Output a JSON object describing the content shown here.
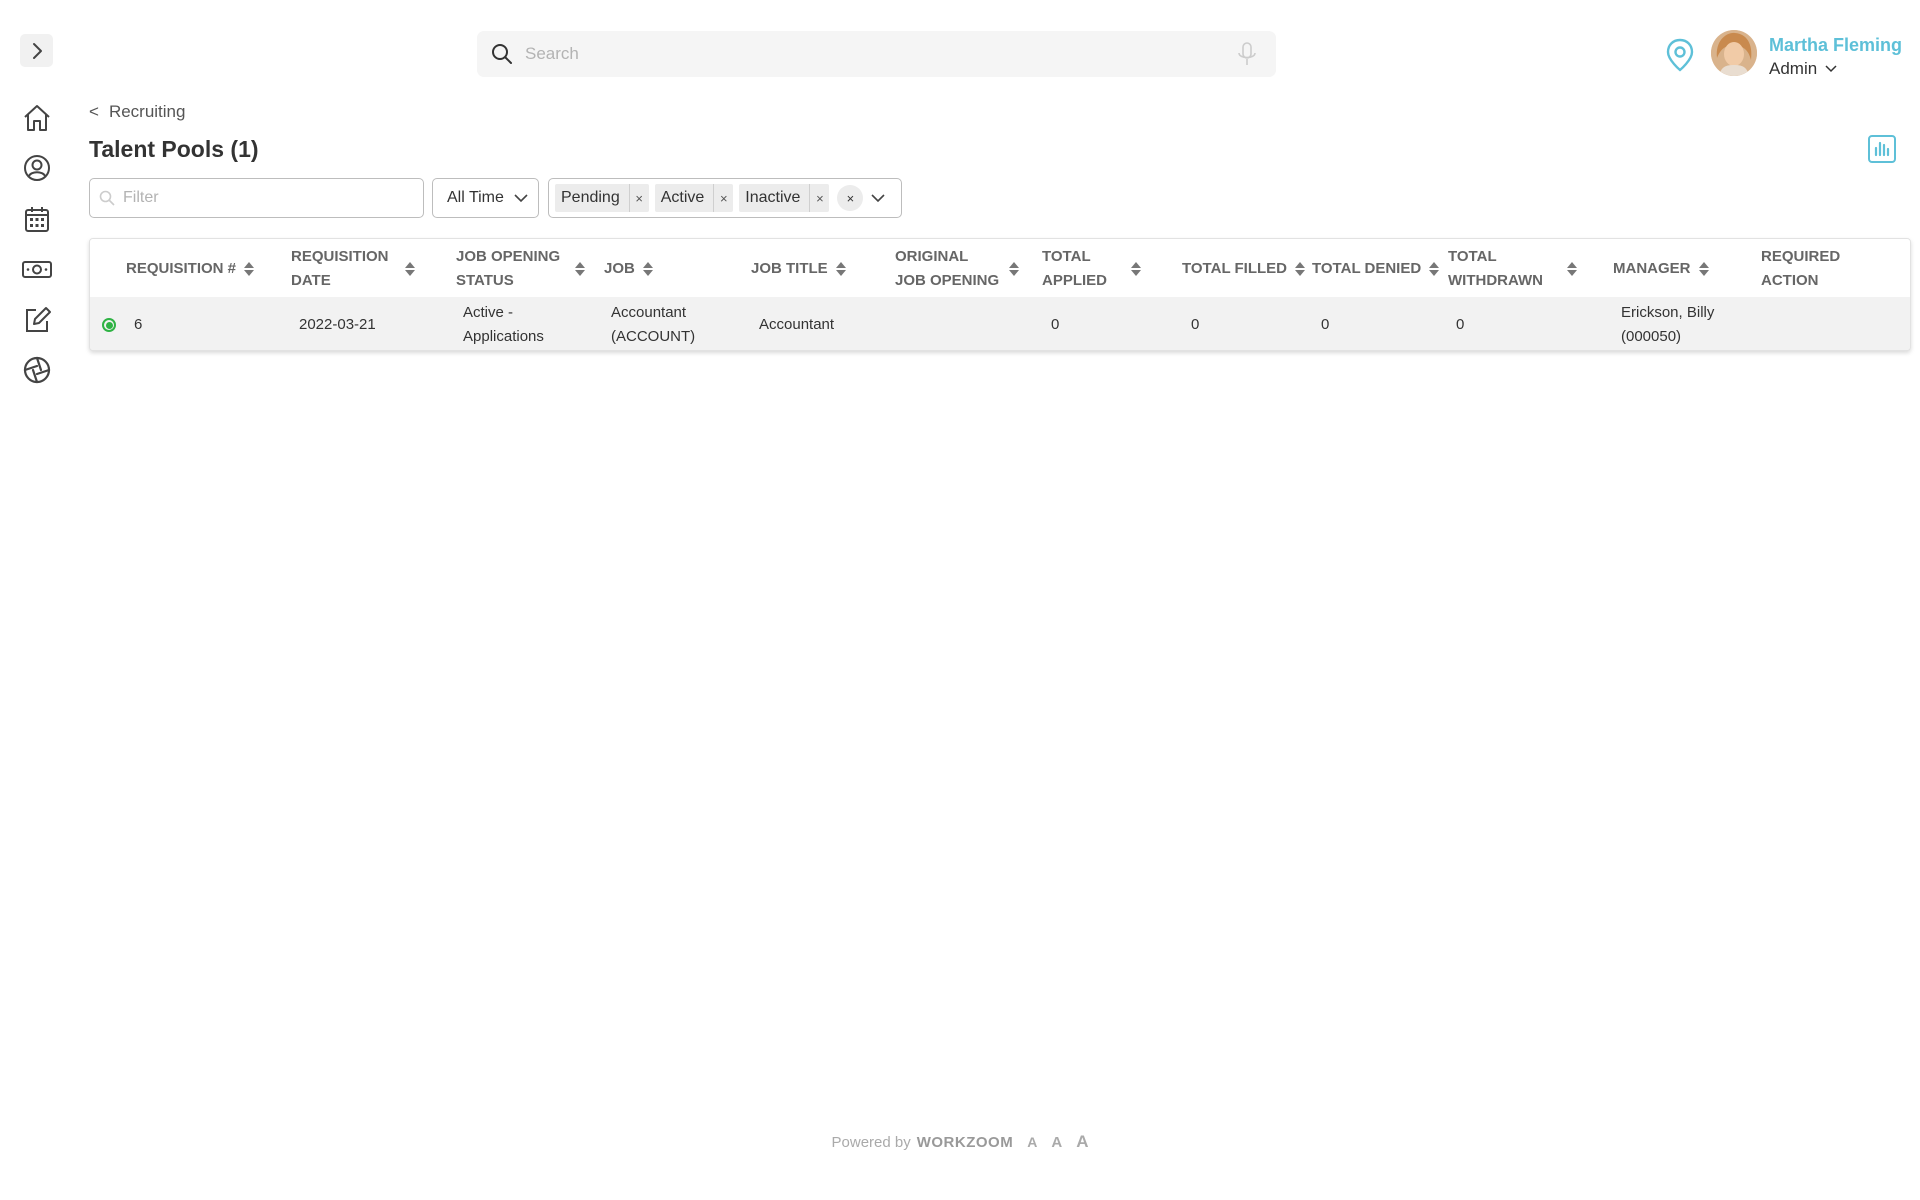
{
  "search": {
    "placeholder": "Search"
  },
  "user": {
    "name": "Martha Fleming",
    "role": "Admin"
  },
  "breadcrumb": {
    "chevron": "<",
    "label": "Recruiting"
  },
  "page": {
    "title": "Talent Pools (1)"
  },
  "filters": {
    "filter_placeholder": "Filter",
    "time_range": "All Time",
    "statuses": [
      "Pending",
      "Active",
      "Inactive"
    ],
    "chip_remove": "×",
    "clear_all": "×"
  },
  "table": {
    "columns": [
      "REQUISITION #",
      "REQUISITION DATE",
      "JOB OPENING STATUS",
      "JOB",
      "JOB TITLE",
      "ORIGINAL JOB OPENING",
      "TOTAL APPLIED",
      "TOTAL FILLED",
      "TOTAL DENIED",
      "TOTAL WITHDRAWN",
      "MANAGER",
      "REQUIRED ACTION"
    ],
    "rows": [
      {
        "requisition": "6",
        "date": "2022-03-21",
        "status": "Active - Applications",
        "job": "Accountant (ACCOUNT)",
        "job_title": "Accountant",
        "original_job_opening": "",
        "total_applied": "0",
        "total_filled": "0",
        "total_denied": "0",
        "total_withdrawn": "0",
        "manager": "Erickson, Billy (000050)",
        "required_action": ""
      }
    ]
  },
  "footer": {
    "powered_by": "Powered by",
    "brand": "WORKZOOM",
    "font_sizes": [
      "A",
      "A",
      "A"
    ]
  },
  "colors": {
    "accent": "#5ec0d8",
    "active_status": "#2fb344"
  }
}
